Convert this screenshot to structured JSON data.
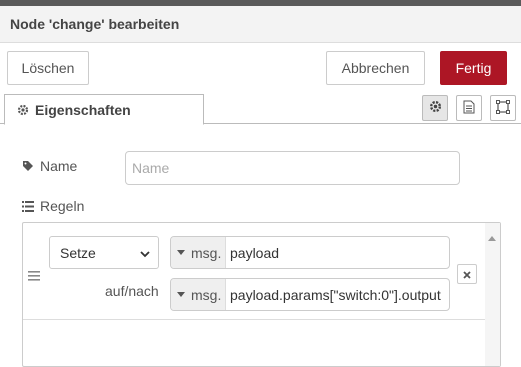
{
  "dialog": {
    "title": "Node 'change' bearbeiten",
    "delete_label": "Löschen",
    "cancel_label": "Abbrechen",
    "done_label": "Fertig",
    "accent": "#ad1625"
  },
  "tabs": {
    "properties_label": "Eigenschaften",
    "icons": [
      "gear-icon",
      "document-icon",
      "frame-icon"
    ]
  },
  "form": {
    "name_label": "Name",
    "name_placeholder": "Name",
    "name_value": "",
    "rules_label": "Regeln"
  },
  "rules": [
    {
      "action": "Setze",
      "property_type": "msg.",
      "property": "payload",
      "to_label": "auf/nach",
      "value_type": "msg.",
      "value": "payload.params[\"switch:0\"].output"
    }
  ]
}
